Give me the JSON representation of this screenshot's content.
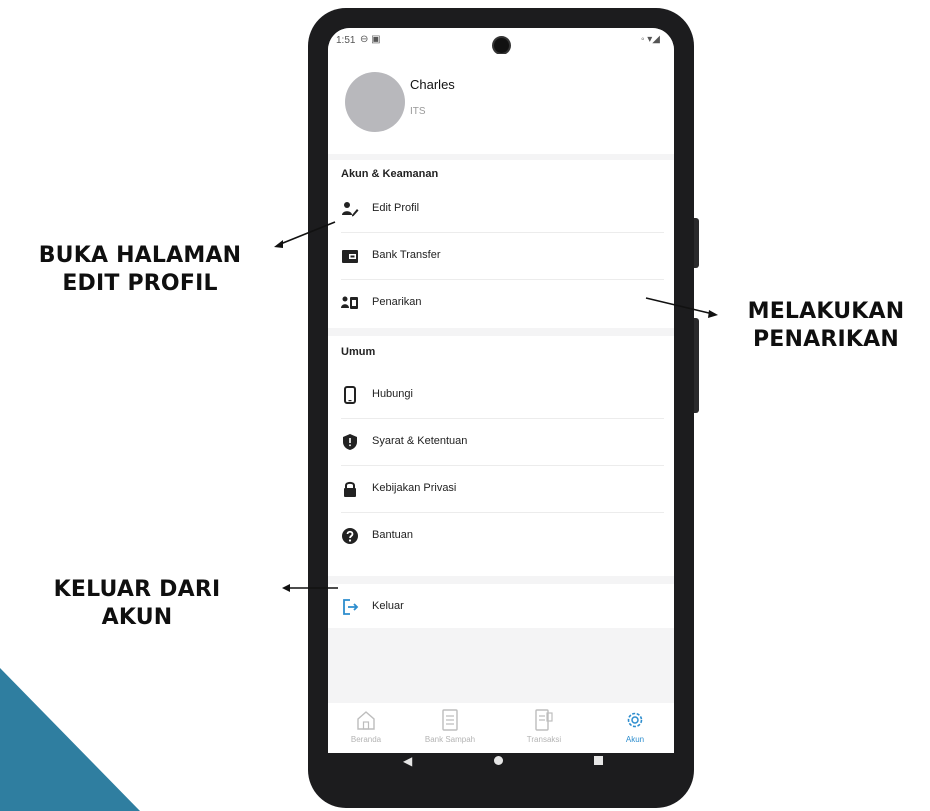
{
  "status_bar": {
    "time": "1:51",
    "left_icons": "⊖ ▣",
    "right_icons": "◦ ▾◢"
  },
  "profile": {
    "name": "Charles",
    "organization": "ITS"
  },
  "sections": {
    "account": {
      "title": "Akun & Keamanan",
      "items": [
        {
          "label": "Edit Profil",
          "icon": "user-edit-icon"
        },
        {
          "label": "Bank Transfer",
          "icon": "wallet-icon"
        },
        {
          "label": "Penarikan",
          "icon": "withdraw-icon"
        }
      ]
    },
    "general": {
      "title": "Umum",
      "items": [
        {
          "label": "Hubungi",
          "icon": "phone-icon"
        },
        {
          "label": "Syarat & Ketentuan",
          "icon": "shield-icon"
        },
        {
          "label": "Kebijakan Privasi",
          "icon": "lock-icon"
        },
        {
          "label": "Bantuan",
          "icon": "help-icon"
        }
      ]
    },
    "logout": {
      "label": "Keluar",
      "icon": "logout-icon"
    }
  },
  "bottom_nav": {
    "items": [
      {
        "label": "Beranda",
        "icon": "home-icon",
        "active": false
      },
      {
        "label": "Bank Sampah",
        "icon": "document-icon",
        "active": false
      },
      {
        "label": "Transaksi",
        "icon": "receipt-icon",
        "active": false
      },
      {
        "label": "Akun",
        "icon": "gear-icon",
        "active": true
      }
    ]
  },
  "callouts": {
    "edit_profile": [
      "BUKA HALAMAN",
      "EDIT PROFIL"
    ],
    "withdraw": [
      "MELAKUKAN",
      "PENARIKAN"
    ],
    "logout": [
      "KELUAR DARI",
      "AKUN"
    ]
  },
  "colors": {
    "accent": "#2d8dce",
    "corner_shape": "#2f7ea0",
    "phone_body": "#1c1c1e",
    "avatar": "#b8b8bc"
  }
}
